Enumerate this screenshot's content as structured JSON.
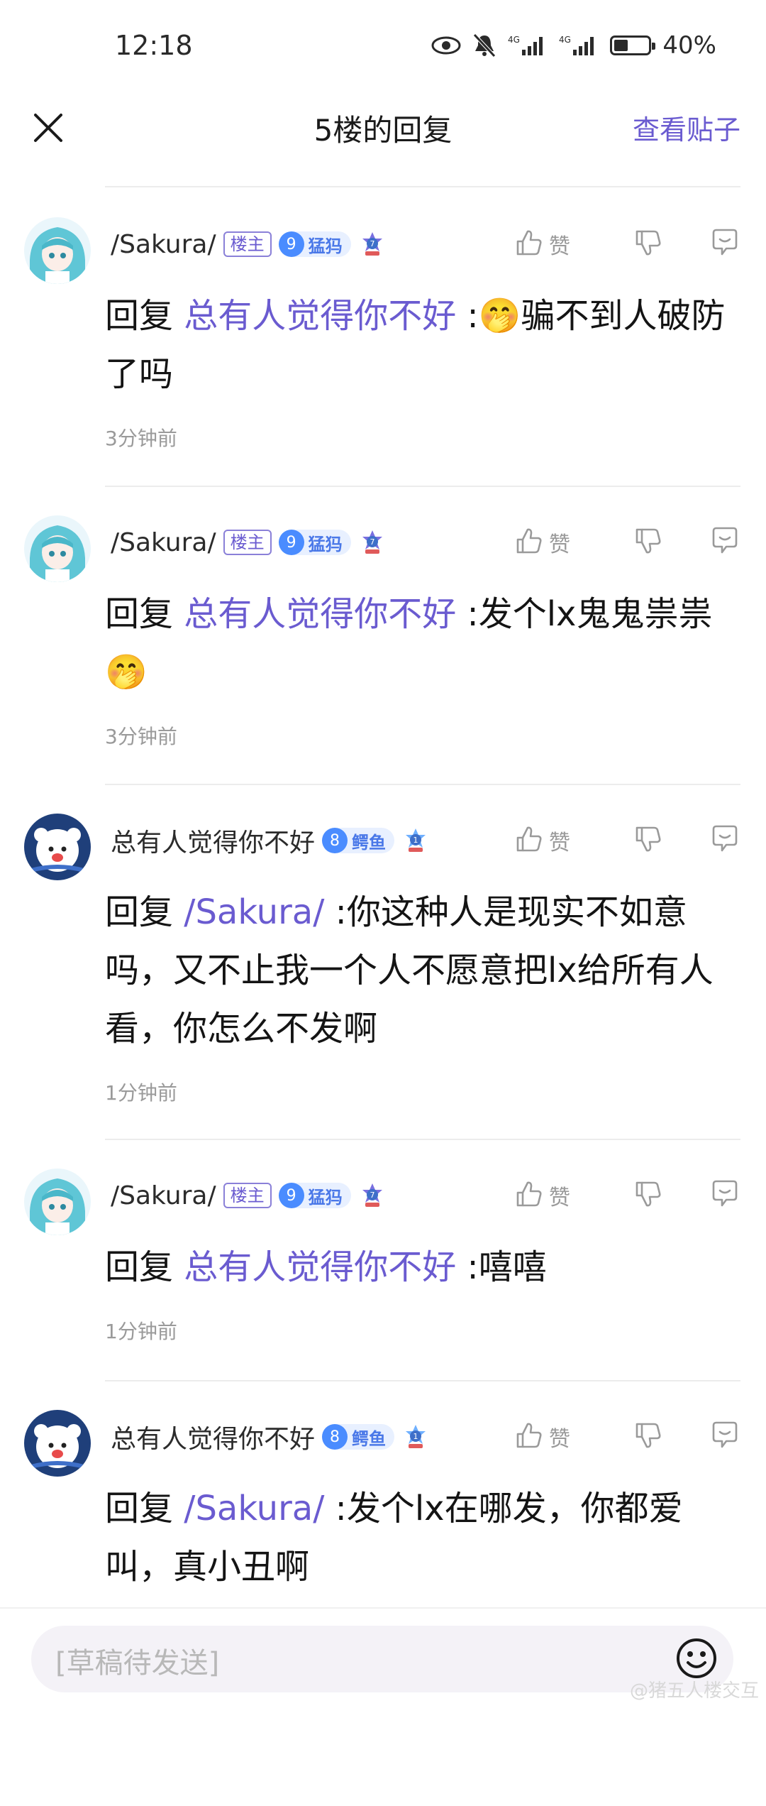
{
  "status_bar": {
    "time": "12:18",
    "battery": "40%",
    "battery_level": 0.4,
    "icons": [
      "eye-icon",
      "bell-mute-icon",
      "signal-4g-icon",
      "signal-4g-icon",
      "battery-icon"
    ]
  },
  "header": {
    "title": "5楼的回复",
    "view_post": "查看贴子",
    "close_icon": "close-icon"
  },
  "colors": {
    "accent": "#6a5bd0",
    "level_blue": "#4a8cff",
    "divider": "#ececec",
    "muted": "#9a9a9a"
  },
  "like_label": "赞",
  "replies": [
    {
      "username": "/Sakura/",
      "owner_badge": "楼主",
      "level": "9",
      "level_name": "猛犸",
      "medal": "7",
      "prefix": "回复",
      "mention": "总有人觉得你不好",
      "text": " :🤭骗不到人破防了吗",
      "time": "3分钟前"
    },
    {
      "username": "/Sakura/",
      "owner_badge": "楼主",
      "level": "9",
      "level_name": "猛犸",
      "medal": "7",
      "prefix": "回复",
      "mention": "总有人觉得你不好",
      "text": " :发个lx鬼鬼祟祟 🤭",
      "time": "3分钟前"
    },
    {
      "username": "总有人觉得你不好",
      "owner_badge": "",
      "level": "8",
      "level_name": "鳄鱼",
      "medal": "1",
      "prefix": "回复",
      "mention": "/Sakura/",
      "text": " :你这种人是现实不如意吗，又不止我一个人不愿意把lx给所有人看，你怎么不发啊",
      "time": "1分钟前"
    },
    {
      "username": "/Sakura/",
      "owner_badge": "楼主",
      "level": "9",
      "level_name": "猛犸",
      "medal": "7",
      "prefix": "回复",
      "mention": "总有人觉得你不好",
      "text": " :嘻嘻",
      "time": "1分钟前"
    },
    {
      "username": "总有人觉得你不好",
      "owner_badge": "",
      "level": "8",
      "level_name": "鳄鱼",
      "medal": "1",
      "prefix": "回复",
      "mention": "/Sakura/",
      "text": " :发个lx在哪发，你都爱叫，真小丑啊",
      "time": ""
    }
  ],
  "bottom_bar": {
    "placeholder": "[草稿待发送]",
    "watermark": "@猪五人楼交互"
  }
}
